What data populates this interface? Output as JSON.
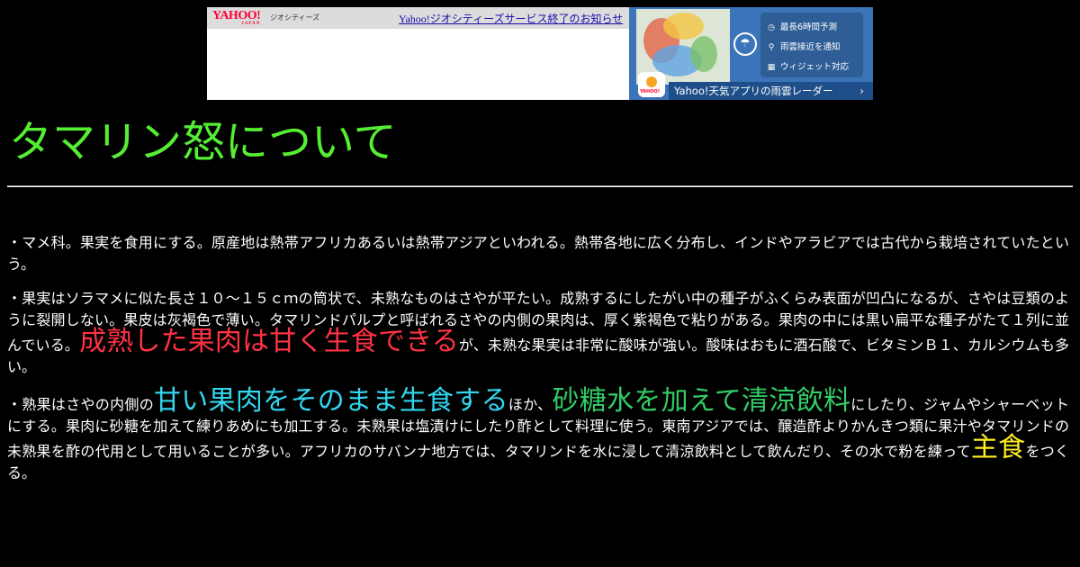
{
  "banner": {
    "logo_text": "YAHOO!",
    "logo_sub": "JAPAN",
    "service_label": "ジオシティーズ",
    "notice_link": "Yahoo!ジオシティーズサービス終了のお知らせ",
    "ad": {
      "app_icon_text": "YAHOO!",
      "features": [
        {
          "icon": "clock-icon",
          "glyph": "◷",
          "label": "最長6時間予測"
        },
        {
          "icon": "pin-icon",
          "glyph": "⚲",
          "label": "雨雲接近を通知"
        },
        {
          "icon": "widget-icon",
          "glyph": "▦",
          "label": "ウィジェット対応"
        }
      ],
      "cta_label": "Yahoo!天気アプリの雨雲レーダー",
      "cta_arrow": "›"
    }
  },
  "title": "タマリン怒について",
  "colors": {
    "background": "#000000",
    "title": "#55ee33",
    "highlight_red": "#ff3344",
    "highlight_cyan": "#33d6ee",
    "highlight_green": "#33cc66",
    "highlight_yellow": "#ffee22"
  },
  "paragraphs": {
    "p1": "・マメ科。果実を食用にする。原産地は熱帯アフリカあるいは熱帯アジアといわれる。熱帯各地に広く分布し、インドやアラビアでは古代から栽培されていたという。",
    "p2_a": "・果実はソラマメに似た長さ１０～１５ｃｍの筒状で、未熟なものはさやが平たい。成熟するにしたがい中の種子がふくらみ表面が凹凸になるが、さやは豆類のように裂開しない。果皮は灰褐色で薄い。タマリンドパルプと呼ばれるさやの内側の果肉は、厚く紫褐色で粘りがある。果肉の中には黒い扁平な種子がたて１列に並んでいる。",
    "p2_hl": "成熟した果肉は甘く生食できる",
    "p2_b": "が、未熟な果実は非常に酸味が強い。酸味はおもに酒石酸で、ビタミンＢ１、カルシウムも多い。",
    "p3_a": "・熟果はさやの内側の",
    "p3_hl1": "甘い果肉をそのまま生食する",
    "p3_b": "ほか、",
    "p3_hl2": "砂糖水を加えて清涼飲料",
    "p3_c": "にしたり、ジャムやシャーベットにする。果肉に砂糖を加えて練りあめにも加工する。未熟果は塩漬けにしたり酢として料理に使う。東南アジアでは、醸造酢よりかんきつ類に果汁やタマリンドの未熟果を酢の代用として用いることが多い。アフリカのサバンナ地方では、タマリンドを水に浸して清涼飲料として飲んだり、その水で粉を練って",
    "p3_hl3": "主食",
    "p3_d": "をつくる。"
  }
}
